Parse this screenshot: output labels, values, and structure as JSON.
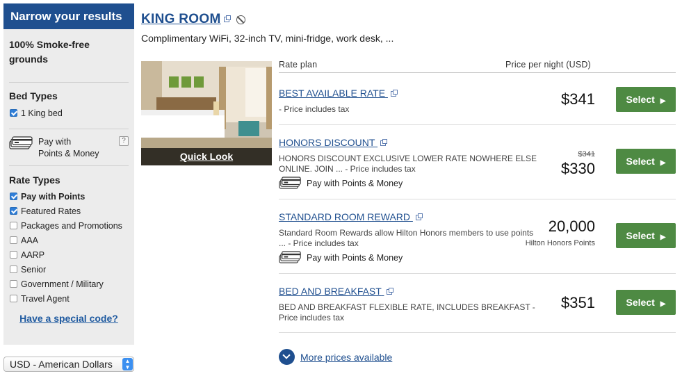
{
  "sidebar": {
    "header": "Narrow your results",
    "smoke_free_line1": "100% Smoke-free",
    "smoke_free_line2": "grounds",
    "bed_types_title": "Bed Types",
    "bed_types": [
      {
        "label": "1 King bed",
        "checked": true
      }
    ],
    "pay_points_line1": "Pay with",
    "pay_points_line2": "Points & Money",
    "help_mark": "?",
    "rate_types_title": "Rate Types",
    "rate_types": [
      {
        "label": "Pay with Points",
        "checked": true
      },
      {
        "label": "Featured Rates",
        "checked": true
      },
      {
        "label": "Packages and Promotions",
        "checked": false
      },
      {
        "label": "AAA",
        "checked": false
      },
      {
        "label": "AARP",
        "checked": false
      },
      {
        "label": "Senior",
        "checked": false
      },
      {
        "label": "Government / Military",
        "checked": false
      },
      {
        "label": "Travel Agent",
        "checked": false
      }
    ],
    "special_code": "Have a special code?"
  },
  "currency": {
    "selected": "USD - American Dollars"
  },
  "room": {
    "title": "KING ROOM",
    "amenities": "Complimentary WiFi, 32-inch TV, mini-fridge, work desk, ...",
    "quick_look": "Quick Look"
  },
  "columns": {
    "rate_plan": "Rate plan",
    "price": "Price per night (USD)"
  },
  "rates": [
    {
      "name": "BEST AVAILABLE RATE",
      "desc": "- Price includes tax",
      "price": "$341",
      "select": "Select"
    },
    {
      "name": "HONORS DISCOUNT",
      "desc": "HONORS DISCOUNT EXCLUSIVE LOWER RATE NOWHERE ELSE ONLINE. JOIN ... - Price includes tax",
      "old_price": "$341",
      "price": "$330",
      "pay_option": "Pay with Points & Money",
      "select": "Select"
    },
    {
      "name": "STANDARD ROOM REWARD",
      "desc": "Standard Room Rewards allow Hilton Honors members to use points ... - Price includes tax",
      "price": "20,000",
      "price_sub": "Hilton Honors Points",
      "pay_option": "Pay with Points & Money",
      "select": "Select"
    },
    {
      "name": "BED AND BREAKFAST",
      "desc": "BED AND BREAKFAST FLEXIBLE RATE, INCLUDES BREAKFAST - Price includes tax",
      "price": "$351",
      "select": "Select"
    }
  ],
  "more_prices": "More prices available"
}
